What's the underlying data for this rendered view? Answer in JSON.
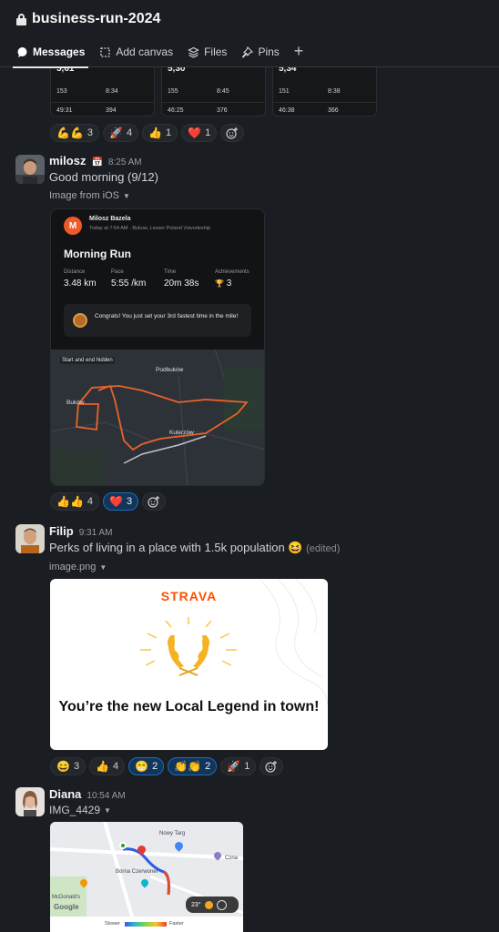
{
  "channel": {
    "name": "business-run-2024"
  },
  "tabs": [
    {
      "label": "Messages"
    },
    {
      "label": "Add canvas"
    },
    {
      "label": "Files"
    },
    {
      "label": "Pins"
    }
  ],
  "top_cards": [
    {
      "distance": "5,61",
      "r1a": "153",
      "r1b": "8:34",
      "r2a": "49:31",
      "r2b": "394"
    },
    {
      "distance": "5,30",
      "r1a": "155",
      "r1b": "8:45",
      "r2a": "46:25",
      "r2b": "376"
    },
    {
      "distance": "5,34",
      "r1a": "151",
      "r1b": "8:38",
      "r2a": "46:38",
      "r2b": "366"
    }
  ],
  "reactions_top": [
    {
      "emoji": "💪💪",
      "count": "3"
    },
    {
      "emoji": "🚀",
      "count": "4"
    },
    {
      "emoji": "👍",
      "count": "1"
    },
    {
      "emoji": "❤️",
      "count": "1"
    }
  ],
  "msg1": {
    "user": "milosz",
    "status_emoji": "📅",
    "time": "8:25 AM",
    "text": "Good morning (9/12)",
    "file_label": "Image from iOS",
    "card": {
      "avatar_letter": "M",
      "athlete": "Milosz Bazela",
      "subtitle": "Today at 7:54 AM · Bukow, Lesser Poland Voivodeship",
      "title": "Morning Run",
      "stats": [
        {
          "label": "Distance",
          "value": "3.48 km"
        },
        {
          "label": "Pace",
          "value": "5:55 /km"
        },
        {
          "label": "Time",
          "value": "20m 38s"
        },
        {
          "label": "Achievements",
          "value": "3"
        }
      ],
      "congrats": "Congrats! You just set your 3rd fastest time in the mile!",
      "map_note": "Start and end hidden",
      "places": [
        "Podbuków",
        "Buków",
        "Kulerzów"
      ]
    },
    "reactions": [
      {
        "emoji": "👍👍",
        "count": "4"
      },
      {
        "emoji": "❤️",
        "count": "3"
      }
    ]
  },
  "msg2": {
    "user": "Filip",
    "time": "9:31 AM",
    "text": "Perks of living in a place with 1.5k population 😆",
    "edited": "(edited)",
    "file_label": "image.png",
    "card": {
      "brand": "STRAVA",
      "headline": "You’re the new Local Legend in town!"
    },
    "reactions": [
      {
        "emoji": "😄",
        "count": "3"
      },
      {
        "emoji": "👍",
        "count": "4"
      },
      {
        "emoji": "😁",
        "count": "2"
      },
      {
        "emoji": "👏👏",
        "count": "2"
      },
      {
        "emoji": "🚀",
        "count": "1"
      }
    ]
  },
  "msg3": {
    "user": "Diana",
    "time": "10:54 AM",
    "file_label": "IMG_4429",
    "map": {
      "places": [
        "Nowy Targ",
        "Borna Czerwonel",
        "McDonald's",
        "Czna"
      ],
      "google": "Google",
      "temp": "23°",
      "slower": "Slower",
      "faster": "Faster"
    }
  },
  "colors": {
    "accent": "#1d6cba",
    "strava": "#fc5200",
    "route": "#e8632a"
  }
}
